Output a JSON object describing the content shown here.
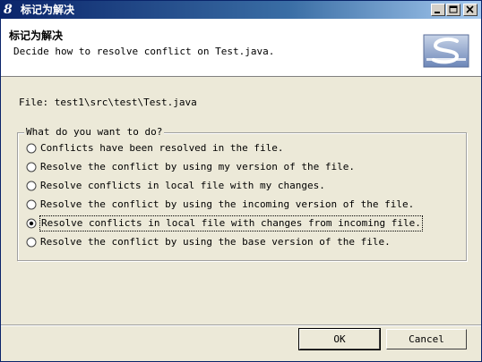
{
  "window": {
    "title": "标记为解决",
    "icon": "eclipse-e-icon",
    "controls": [
      "minimize",
      "maximize",
      "close"
    ]
  },
  "header": {
    "title": "标记为解决",
    "message": "Decide how to resolve conflict on Test.java.",
    "logo": "subversion-logo"
  },
  "file": {
    "label": "File:",
    "path": "test1\\src\\test\\Test.java"
  },
  "group": {
    "legend": "What do you want to do?",
    "options": [
      {
        "label": "Conflicts have been resolved in the file.",
        "selected": false
      },
      {
        "label": "Resolve the conflict by using my version of the file.",
        "selected": false
      },
      {
        "label": "Resolve conflicts in local file with my changes.",
        "selected": false
      },
      {
        "label": "Resolve the conflict by using the incoming version of the file.",
        "selected": false
      },
      {
        "label": "Resolve conflicts in local file with changes from incoming file.",
        "selected": true
      },
      {
        "label": "Resolve the conflict by using the base version of the file.",
        "selected": false
      }
    ]
  },
  "buttons": {
    "ok": "OK",
    "cancel": "Cancel"
  }
}
